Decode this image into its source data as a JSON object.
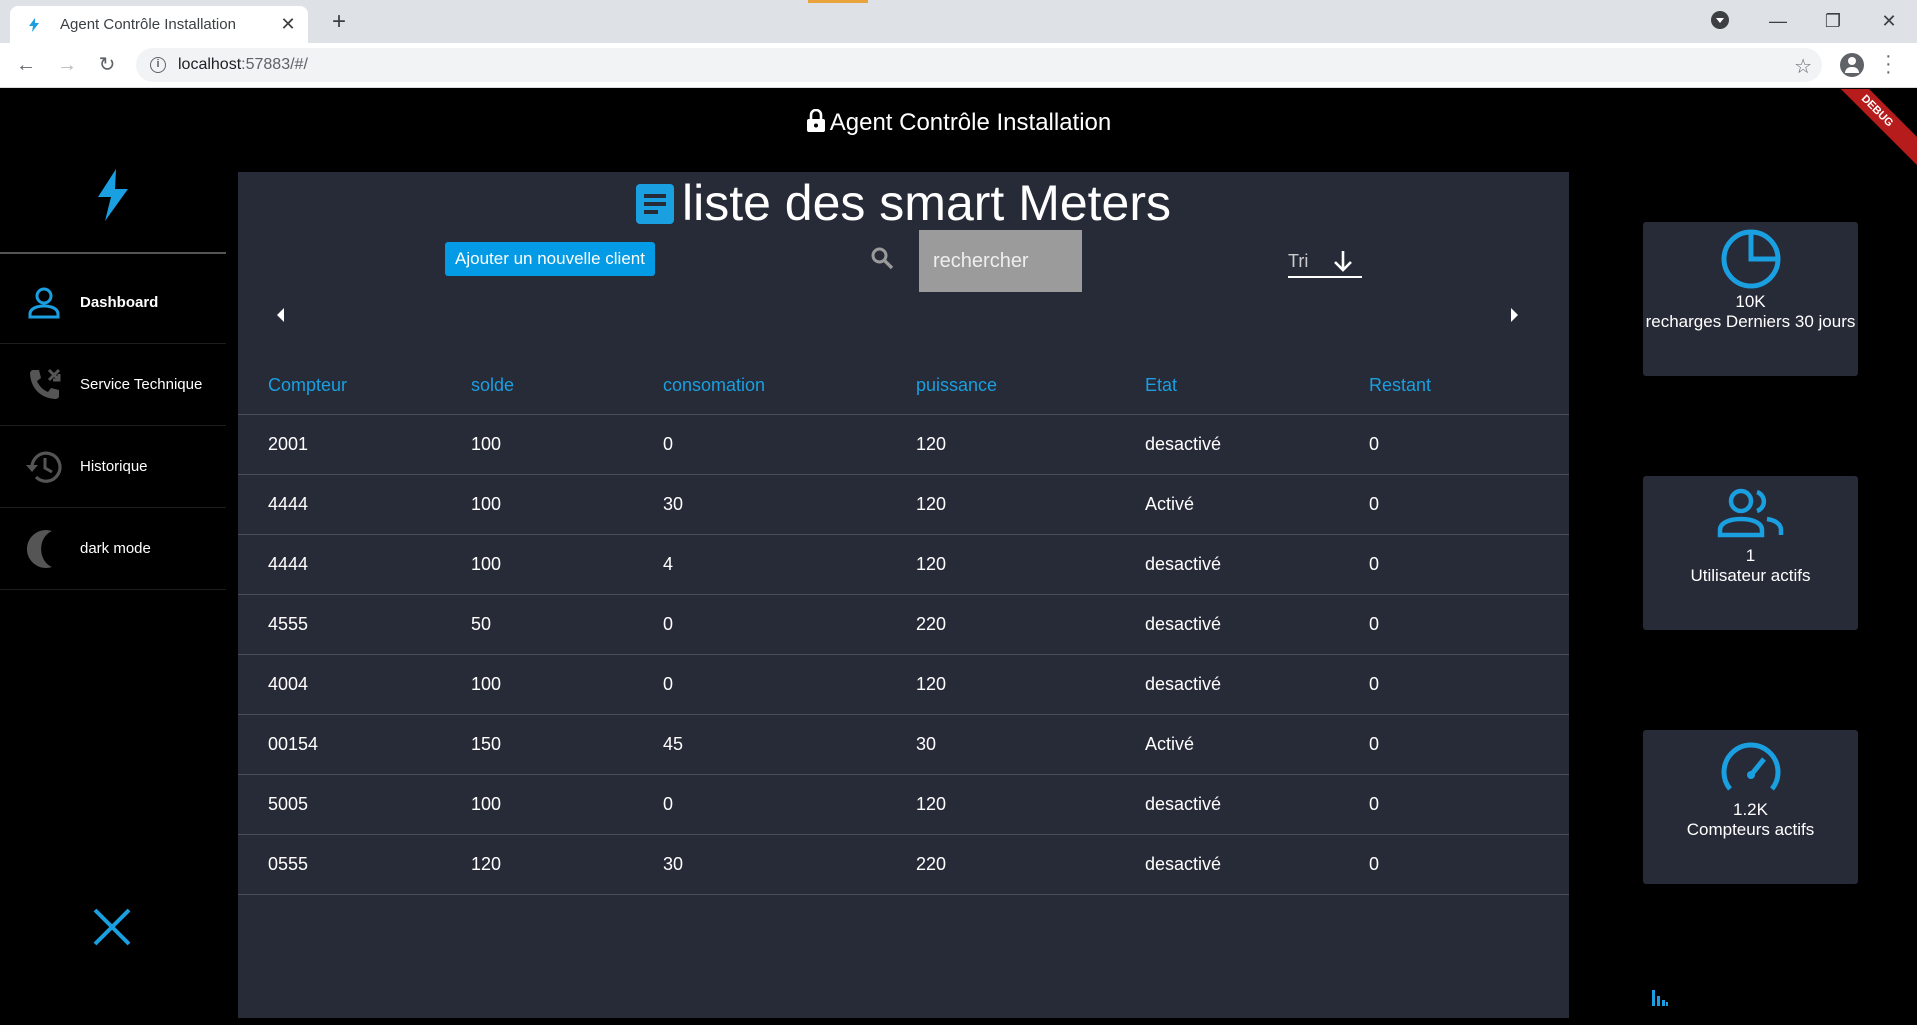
{
  "browser": {
    "tab_title": "Agent Contrôle Installation",
    "url_host": "localhost",
    "url_rest": ":57883/#/"
  },
  "app": {
    "title": "Agent Contrôle Installation",
    "debug_label": "DEBUG",
    "accent_color": "#1a9fe0"
  },
  "sidebar": {
    "items": [
      {
        "label": "Dashboard",
        "icon": "person-icon"
      },
      {
        "label": "Service Technique",
        "icon": "phone-forwarded-icon"
      },
      {
        "label": "Historique",
        "icon": "history-icon"
      },
      {
        "label": "dark mode",
        "icon": "moon-icon"
      }
    ]
  },
  "main": {
    "title": "liste des smart Meters",
    "add_button": "Ajouter un nouvelle client",
    "search_placeholder": "rechercher",
    "sort_label": "Tri",
    "columns": [
      "Compteur",
      "solde",
      "consomation",
      "puissance",
      "Etat",
      "Restant"
    ],
    "rows": [
      [
        "2001",
        "100",
        "0",
        "120",
        "desactivé",
        "0"
      ],
      [
        "4444",
        "100",
        "30",
        "120",
        "Activé",
        "0"
      ],
      [
        "4444",
        "100",
        "4",
        "120",
        "desactivé",
        "0"
      ],
      [
        "4555",
        "50",
        "0",
        "220",
        "desactivé",
        "0"
      ],
      [
        "4004",
        "100",
        "0",
        "120",
        "desactivé",
        "0"
      ],
      [
        "00154",
        "150",
        "45",
        "30",
        "Activé",
        "0"
      ],
      [
        "5005",
        "100",
        "0",
        "120",
        "desactivé",
        "0"
      ],
      [
        "0555",
        "120",
        "30",
        "220",
        "desactivé",
        "0"
      ]
    ]
  },
  "stats": [
    {
      "value": "10K",
      "label": "recharges Derniers 30 jours",
      "icon": "pie-chart-icon"
    },
    {
      "value": "1",
      "label": "Utilisateur actifs",
      "icon": "users-icon"
    },
    {
      "value": "1.2K",
      "label": "Compteurs actifs",
      "icon": "speedometer-icon"
    }
  ]
}
